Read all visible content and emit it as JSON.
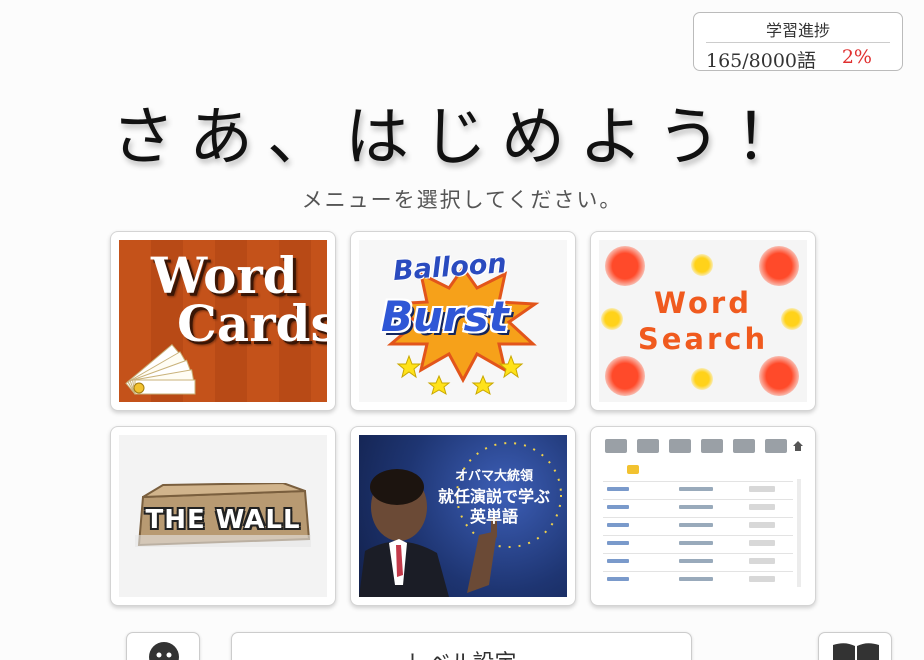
{
  "progress": {
    "title": "学習進捗",
    "count": "165/8000語",
    "percent": "2%",
    "percent_color": "#e03030"
  },
  "header": {
    "title": "さあ、はじめよう！",
    "subtitle": "メニューを選択してください。"
  },
  "menu": {
    "word_cards": {
      "line1": "Word",
      "line2": "Cards",
      "icon": "card-fan-icon"
    },
    "balloon_burst": {
      "line1": "Balloon",
      "line2": "Burst",
      "icon": "starburst-icon"
    },
    "word_search": {
      "line1": "Word",
      "line2": "Search"
    },
    "the_wall": {
      "text": "THE WALL",
      "icon": "cardboard-box-icon"
    },
    "obama": {
      "line1": "オバマ大統領",
      "line2": "就任演説で学ぶ",
      "line3": "英単語"
    },
    "word_list": {
      "icon": "home-icon"
    }
  },
  "bottom_bar": {
    "left_icon": "user-face-icon",
    "center_label": "レベル設定",
    "right_icon": "open-book-icon"
  }
}
